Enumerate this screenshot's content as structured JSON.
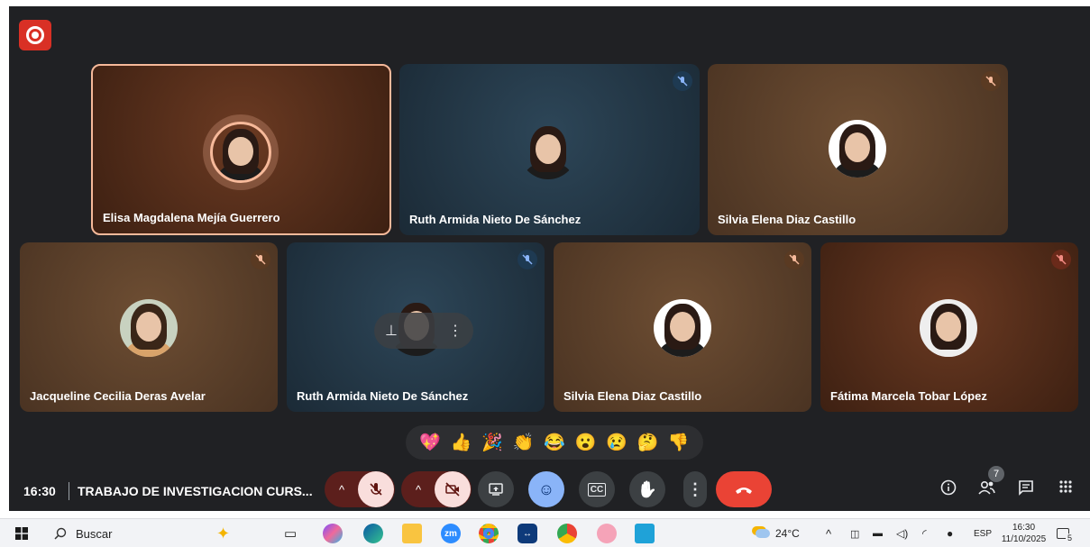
{
  "meeting": {
    "time": "16:30",
    "title": "TRABAJO DE INVESTIGACION CURS...",
    "participant_count": "7"
  },
  "tiles": [
    {
      "name": "Elisa Magdalena Mejía Guerrero",
      "muted": false,
      "active_speaker": true
    },
    {
      "name": "Ruth Armida Nieto De Sánchez",
      "muted": true
    },
    {
      "name": "Silvia Elena Diaz Castillo",
      "muted": true
    },
    {
      "name": "Jacqueline Cecilia Deras Avelar",
      "muted": true
    },
    {
      "name": "Ruth Armida Nieto De Sánchez",
      "muted": true
    },
    {
      "name": "Silvia Elena Diaz Castillo",
      "muted": true
    },
    {
      "name": "Fátima Marcela Tobar López",
      "muted": true
    }
  ],
  "reactions": [
    "💖",
    "👍",
    "🎉",
    "👏",
    "😂",
    "😮",
    "😢",
    "🤔",
    "👎"
  ],
  "icons": {
    "mic_off": "🎙",
    "cam_off": "⊘",
    "present": "⬆",
    "emoji": "☺",
    "captions": "CC",
    "hand": "✋",
    "more": "⋮",
    "leave": "☎",
    "info": "ⓘ",
    "people": "👥",
    "chat": "▤",
    "apps": "⁝⁝",
    "chevron_up": "^"
  },
  "taskbar": {
    "search_label": "Buscar",
    "weather": "24°C",
    "language": "ESP",
    "clock_time": "16:30",
    "clock_date": "11/10/2025",
    "notification_count": "5",
    "zoom_label": "zm"
  },
  "colors": {
    "meet_bg": "#202124",
    "record_red": "#d93025",
    "leave_red": "#ea4335",
    "active_border": "#f6b99a"
  }
}
